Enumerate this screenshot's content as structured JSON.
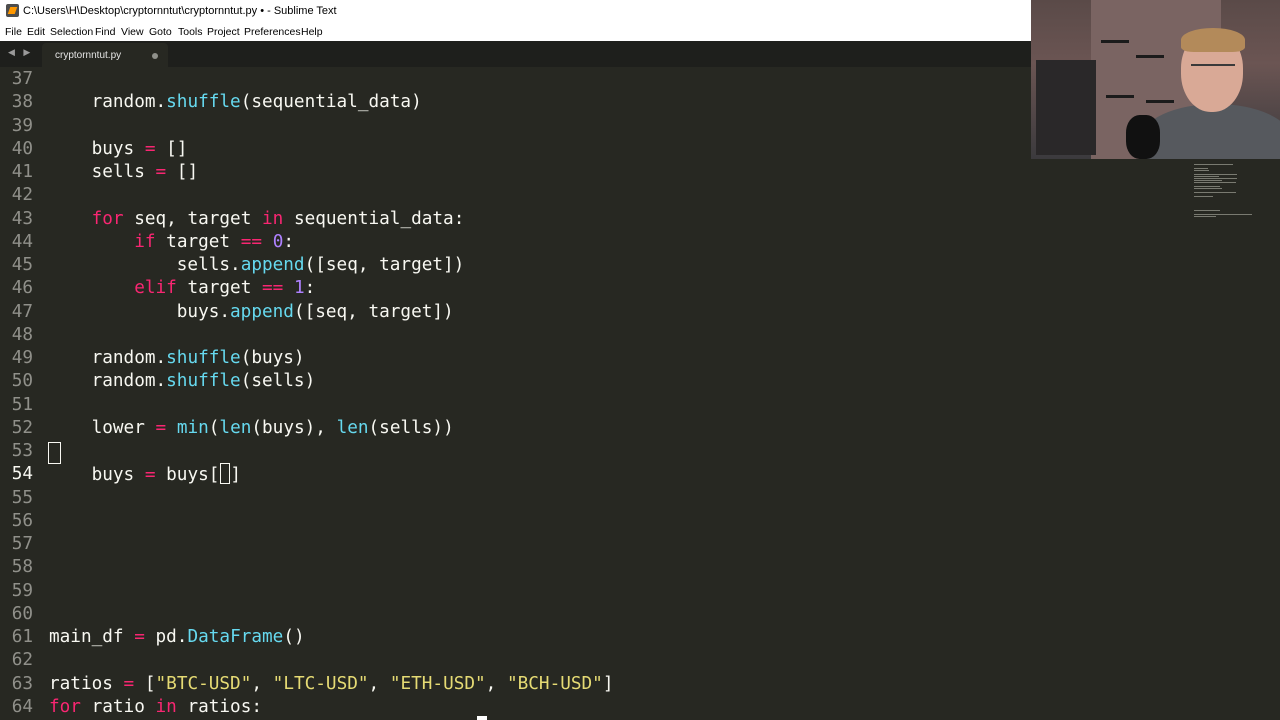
{
  "window": {
    "title": "C:\\Users\\H\\Desktop\\cryptornntut\\cryptornntut.py • - Sublime Text"
  },
  "menu": [
    "File",
    "Edit",
    "Selection",
    "Find",
    "View",
    "Goto",
    "Tools",
    "Project",
    "Preferences",
    "Help"
  ],
  "tab": {
    "label": "cryptornntut.py"
  },
  "editor": {
    "current_line": 54,
    "lines": [
      {
        "n": "37",
        "tokens": []
      },
      {
        "n": "38",
        "tokens": [
          [
            "plain",
            "    random."
          ],
          [
            "fn",
            "shuffle"
          ],
          [
            "plain",
            "(sequential_data)"
          ]
        ]
      },
      {
        "n": "39",
        "tokens": []
      },
      {
        "n": "40",
        "tokens": [
          [
            "plain",
            "    buys "
          ],
          [
            "op",
            "="
          ],
          [
            "plain",
            " []"
          ]
        ]
      },
      {
        "n": "41",
        "tokens": [
          [
            "plain",
            "    sells "
          ],
          [
            "op",
            "="
          ],
          [
            "plain",
            " []"
          ]
        ]
      },
      {
        "n": "42",
        "tokens": []
      },
      {
        "n": "43",
        "tokens": [
          [
            "plain",
            "    "
          ],
          [
            "kw",
            "for"
          ],
          [
            "plain",
            " seq, target "
          ],
          [
            "kw",
            "in"
          ],
          [
            "plain",
            " sequential_data:"
          ]
        ]
      },
      {
        "n": "44",
        "tokens": [
          [
            "plain",
            "        "
          ],
          [
            "kw",
            "if"
          ],
          [
            "plain",
            " target "
          ],
          [
            "op",
            "=="
          ],
          [
            "plain",
            " "
          ],
          [
            "num",
            "0"
          ],
          [
            "plain",
            ":"
          ]
        ]
      },
      {
        "n": "45",
        "tokens": [
          [
            "plain",
            "            sells."
          ],
          [
            "fn",
            "append"
          ],
          [
            "plain",
            "([seq, target])"
          ]
        ]
      },
      {
        "n": "46",
        "tokens": [
          [
            "plain",
            "        "
          ],
          [
            "kw",
            "elif"
          ],
          [
            "plain",
            " target "
          ],
          [
            "op",
            "=="
          ],
          [
            "plain",
            " "
          ],
          [
            "num",
            "1"
          ],
          [
            "plain",
            ":"
          ]
        ]
      },
      {
        "n": "47",
        "tokens": [
          [
            "plain",
            "            buys."
          ],
          [
            "fn",
            "append"
          ],
          [
            "plain",
            "([seq, target])"
          ]
        ]
      },
      {
        "n": "48",
        "tokens": []
      },
      {
        "n": "49",
        "tokens": [
          [
            "plain",
            "    random."
          ],
          [
            "fn",
            "shuffle"
          ],
          [
            "plain",
            "(buys)"
          ]
        ]
      },
      {
        "n": "50",
        "tokens": [
          [
            "plain",
            "    random."
          ],
          [
            "fn",
            "shuffle"
          ],
          [
            "plain",
            "(sells)"
          ]
        ]
      },
      {
        "n": "51",
        "tokens": []
      },
      {
        "n": "52",
        "tokens": [
          [
            "plain",
            "    lower "
          ],
          [
            "op",
            "="
          ],
          [
            "plain",
            " "
          ],
          [
            "fn",
            "min"
          ],
          [
            "plain",
            "("
          ],
          [
            "fn",
            "len"
          ],
          [
            "plain",
            "(buys), "
          ],
          [
            "fn",
            "len"
          ],
          [
            "plain",
            "(sells))"
          ]
        ]
      },
      {
        "n": "53",
        "tokens": []
      },
      {
        "n": "54",
        "tokens": [
          [
            "plain",
            "    buys "
          ],
          [
            "op",
            "="
          ],
          [
            "plain",
            " buys["
          ],
          [
            "cursor",
            ""
          ],
          [
            "plain",
            "]"
          ]
        ]
      },
      {
        "n": "55",
        "tokens": []
      },
      {
        "n": "56",
        "tokens": []
      },
      {
        "n": "57",
        "tokens": []
      },
      {
        "n": "58",
        "tokens": []
      },
      {
        "n": "59",
        "tokens": []
      },
      {
        "n": "60",
        "tokens": []
      },
      {
        "n": "61",
        "tokens": [
          [
            "plain",
            "main_df "
          ],
          [
            "op",
            "="
          ],
          [
            "plain",
            " pd."
          ],
          [
            "fn",
            "DataFrame"
          ],
          [
            "plain",
            "()"
          ]
        ]
      },
      {
        "n": "62",
        "tokens": []
      },
      {
        "n": "63",
        "tokens": [
          [
            "plain",
            "ratios "
          ],
          [
            "op",
            "="
          ],
          [
            "plain",
            " ["
          ],
          [
            "str",
            "\"BTC-USD\""
          ],
          [
            "plain",
            ", "
          ],
          [
            "str",
            "\"LTC-USD\""
          ],
          [
            "plain",
            ", "
          ],
          [
            "str",
            "\"ETH-USD\""
          ],
          [
            "plain",
            ", "
          ],
          [
            "str",
            "\"BCH-USD\""
          ],
          [
            "plain",
            "]"
          ]
        ]
      },
      {
        "n": "64",
        "tokens": [
          [
            "kw",
            "for"
          ],
          [
            "plain",
            " ratio "
          ],
          [
            "kw",
            "in"
          ],
          [
            "plain",
            " ratios:"
          ]
        ]
      }
    ]
  },
  "colors": {
    "background": "#272822",
    "keyword": "#f92672",
    "function": "#66d9ef",
    "string": "#e6db74",
    "number": "#ae81ff",
    "text": "#f8f8f2",
    "gutter": "#90908a"
  }
}
